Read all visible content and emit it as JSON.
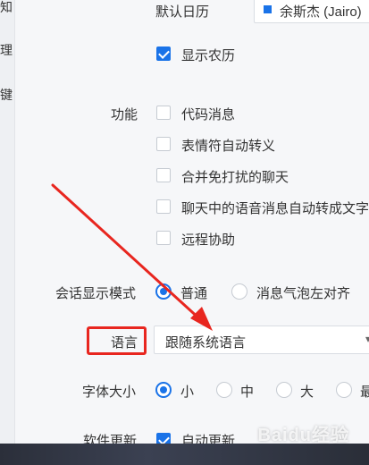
{
  "left_nav": {
    "items": [
      "知",
      "理",
      "键"
    ]
  },
  "calendar": {
    "label": "默认日历",
    "selected": "余斯杰 (Jairo)",
    "accent_color": "#1a73e8",
    "show_lunar": {
      "label": "显示农历",
      "checked": true
    }
  },
  "features": {
    "label": "功能",
    "options": [
      {
        "label": "代码消息",
        "checked": false
      },
      {
        "label": "表情符自动转义",
        "checked": false
      },
      {
        "label": "合并免打扰的聊天",
        "checked": false
      },
      {
        "label": "聊天中的语音消息自动转成文字",
        "checked": false
      },
      {
        "label": "远程协助",
        "checked": false
      }
    ]
  },
  "session_mode": {
    "label": "会话显示模式",
    "options": [
      {
        "label": "普通",
        "selected": true
      },
      {
        "label": "消息气泡左对齐",
        "selected": false
      }
    ]
  },
  "language": {
    "label": "语言",
    "value": "跟随系统语言"
  },
  "font_size": {
    "label": "字体大小",
    "options": [
      {
        "label": "小",
        "selected": true
      },
      {
        "label": "中",
        "selected": false
      },
      {
        "label": "大",
        "selected": false
      },
      {
        "label": "最",
        "selected": false
      }
    ]
  },
  "software_update": {
    "label": "软件更新",
    "auto_update": {
      "label": "自动更新",
      "checked": true
    }
  },
  "annotation": {
    "highlight_color": "#e8261f"
  },
  "watermark": {
    "text": "Baidu经验"
  }
}
